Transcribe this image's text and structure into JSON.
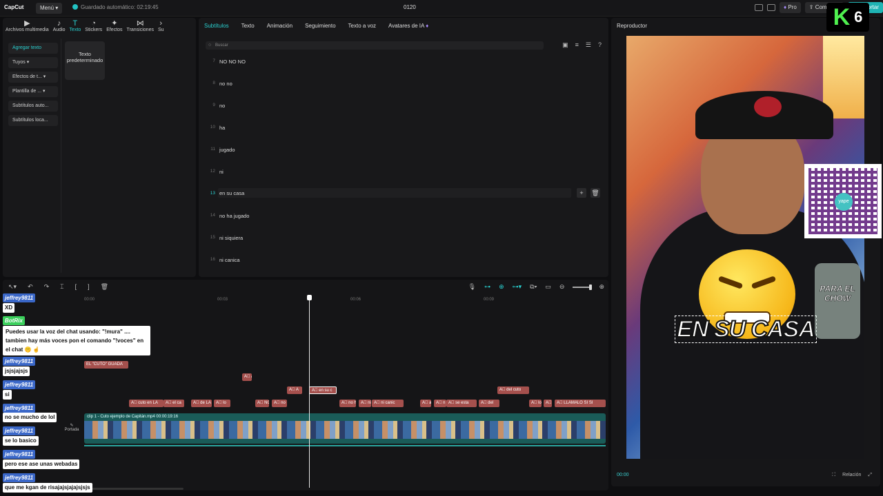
{
  "topbar": {
    "logo": "CapCut",
    "menu": "Menú",
    "autosave": "Guardado automático: 02:19:45",
    "project_name": "0120",
    "pro": "Pro",
    "share": "Compartir",
    "export": "Exportar"
  },
  "toolbar": {
    "tools": [
      {
        "label": "Archivos multimedia",
        "icon": "media-icon"
      },
      {
        "label": "Audio",
        "icon": "audio-icon"
      },
      {
        "label": "Texto",
        "icon": "text-icon",
        "active": true
      },
      {
        "label": "Stickers",
        "icon": "sticker-icon"
      },
      {
        "label": "Efectos",
        "icon": "effects-icon"
      },
      {
        "label": "Transiciones",
        "icon": "transitions-icon"
      },
      {
        "label": "Su",
        "icon": "more-icon"
      }
    ]
  },
  "sidemenu": {
    "items": [
      "Agregar texto",
      "Tuyos",
      "Efectos de t...",
      "Plantilla de ...",
      "Subtítulos auto...",
      "Subtítulos loca..."
    ],
    "preset_card": "Texto predeterminado"
  },
  "subtitle_panel": {
    "tabs": [
      "Subtítulos",
      "Texto",
      "Animación",
      "Seguimiento",
      "Texto a voz",
      "Avatares de IA"
    ],
    "search_placeholder": "Buscar",
    "rows": [
      {
        "num": "7",
        "text": "NO NO NO"
      },
      {
        "num": "8",
        "text": "no no"
      },
      {
        "num": "9",
        "text": "no"
      },
      {
        "num": "10",
        "text": "ha"
      },
      {
        "num": "11",
        "text": "jugado"
      },
      {
        "num": "12",
        "text": "ni"
      },
      {
        "num": "13",
        "text": "en su casa",
        "selected": true
      },
      {
        "num": "14",
        "text": "no ha jugado"
      },
      {
        "num": "15",
        "text": "ni siquiera"
      },
      {
        "num": "16",
        "text": "ni canica"
      }
    ]
  },
  "player": {
    "title": "Reproductor",
    "caption": "EN SU CASA",
    "jar_text": "PARA EL CHOW",
    "qr_label": "yape",
    "time": "00:00",
    "ratio": "Relación",
    "badge_letter": "K",
    "badge_number": "6"
  },
  "timeline": {
    "ruler": [
      "00:00",
      "00:03",
      "00:06",
      "00:09"
    ],
    "video_clip_label": "clip 1 - Cuto ejemplo de Capitán.mp4  00:00:19:16",
    "cover_label": "Portada",
    "text_clips": [
      {
        "label": "EL \"CUTO\" GUADA",
        "row": 0
      },
      {
        "label": "A",
        "row": 1
      },
      {
        "label": "A",
        "row": 2
      },
      {
        "label": "en su c",
        "row": 2,
        "selected": true
      },
      {
        "label": "del cuto",
        "row": 2
      },
      {
        "label": "cuto en LA",
        "row": 3
      },
      {
        "label": "el ca",
        "row": 3
      },
      {
        "label": "de LA",
        "row": 3
      },
      {
        "label": "lo",
        "row": 3
      },
      {
        "label": "NO",
        "row": 3
      },
      {
        "label": "no",
        "row": 3
      },
      {
        "label": "no h",
        "row": 3
      },
      {
        "label": "ni s",
        "row": 3
      },
      {
        "label": "ni canic",
        "row": 3
      },
      {
        "label": "a",
        "row": 3
      },
      {
        "label": "n",
        "row": 3
      },
      {
        "label": "se esta",
        "row": 3
      },
      {
        "label": "del",
        "row": 3
      },
      {
        "label": "lo",
        "row": 3
      },
      {
        "label": "E",
        "row": 3
      },
      {
        "label": "LLAMALO SI SI",
        "row": 3
      }
    ]
  },
  "chat": [
    {
      "user": "jeffrey9811",
      "msg": "XD"
    },
    {
      "user": "BotRix",
      "msg": "Puedes usar la voz del chat usando: \"!mura\" .... tambien hay más voces pon el comando \"!voces\" en el chat 🤫 ☝",
      "bot": true
    },
    {
      "user": "jeffrey9811",
      "msg": "jsjsjajsjs"
    },
    {
      "user": "jeffrey9811",
      "msg": "si"
    },
    {
      "user": "jeffrey9811",
      "msg": "no se mucho de lol"
    },
    {
      "user": "jeffrey9811",
      "msg": "se lo basico"
    },
    {
      "user": "jeffrey9811",
      "msg": "pero ese ase unas webadas"
    },
    {
      "user": "jeffrey9811",
      "msg": "que me kgan de risajajsjajajsjsjs"
    }
  ]
}
